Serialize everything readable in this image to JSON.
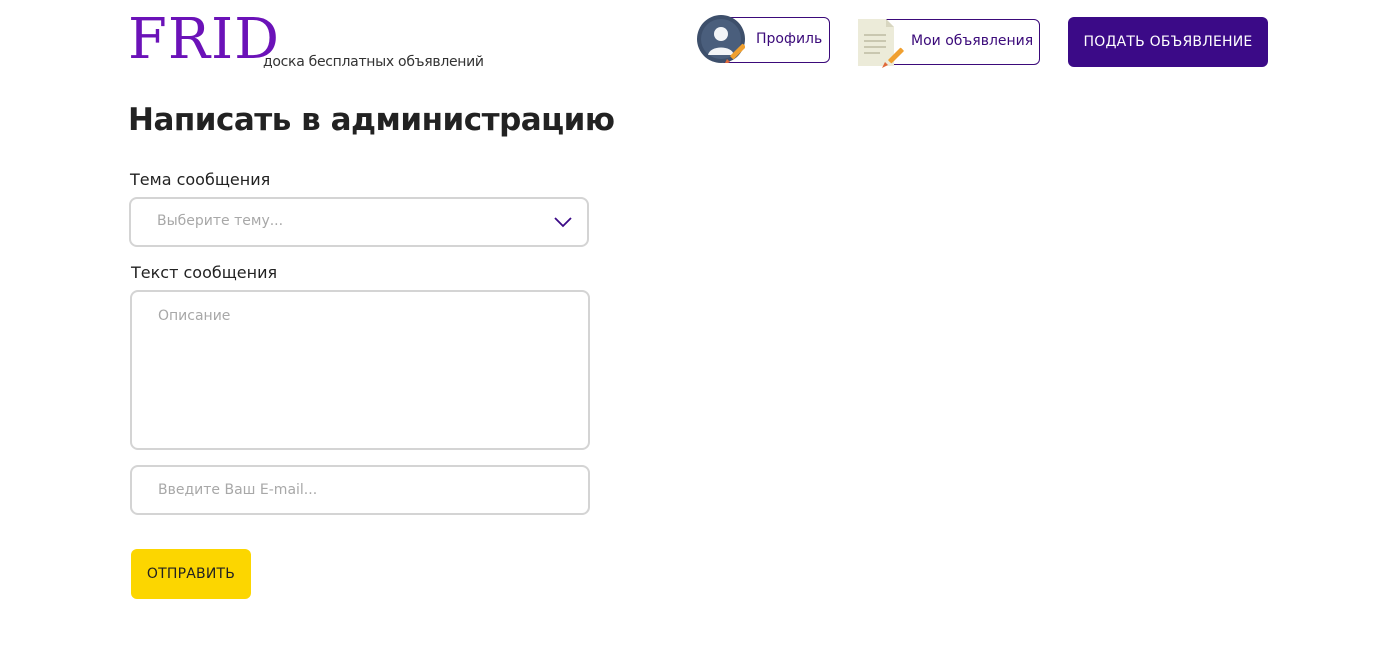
{
  "header": {
    "logo_text": "FRID",
    "logo_subtitle": "доска бесплатных объявлений",
    "profile_label": "Профиль",
    "my_ads_label": "Мои объявления",
    "post_ad_label": "ПОДАТЬ ОБЪЯВЛЕНИЕ"
  },
  "page": {
    "title": "Написать в администрацию"
  },
  "form": {
    "subject_label": "Тема сообщения",
    "subject_placeholder": "Выберите тему...",
    "message_label": "Текст сообщения",
    "message_placeholder": "Описание",
    "email_placeholder": "Введите Ваш E-mail...",
    "submit_label": "ОТПРАВИТЬ"
  },
  "icons": {
    "avatar": "user-avatar-icon",
    "edit_pencil": "pencil-icon",
    "document": "document-icon",
    "chevron": "chevron-down-icon"
  },
  "colors": {
    "brand_purple": "#6b12b8",
    "primary_dark_purple": "#3b0a87",
    "accent_yellow": "#fcd600",
    "border_gray": "#d4d4d4",
    "placeholder_gray": "#a8a8a8"
  }
}
